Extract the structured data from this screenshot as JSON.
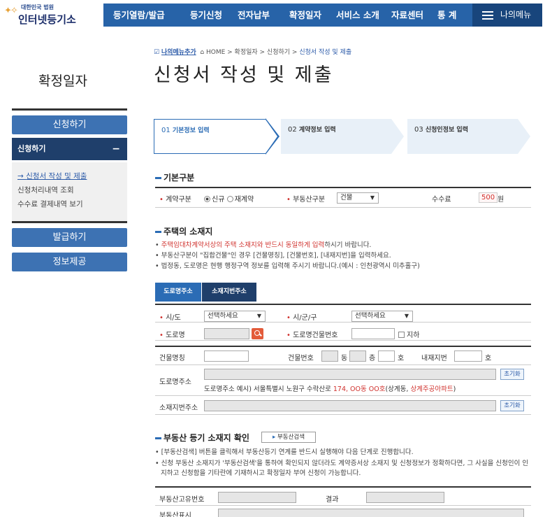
{
  "header": {
    "logo_small": "대한민국 법원",
    "logo_big": "인터넷등기소",
    "nav": [
      "등기열람/발급",
      "등기신청",
      "전자납부",
      "확정일자",
      "서비스 소개",
      "자료센터",
      "통 계"
    ],
    "my_menu": "나의메뉴"
  },
  "sidebar": {
    "title": "확정일자",
    "apply_head": "신청하기",
    "sub_head": "신청하기",
    "sub_toggle": "−",
    "links": [
      "신청서 작성 및 제출",
      "신청처리내역 조회",
      "수수료 결제내역 보기"
    ],
    "issue_head": "발급하기",
    "info_head": "정보제공"
  },
  "breadcrumb": {
    "add_menu": "나의메뉴추가",
    "path": "HOME > 확정일자 > 신청하기 > ",
    "current": "신청서 작성 및 제출"
  },
  "page_title": "신청서 작성 및 제출",
  "steps": [
    {
      "num": "01",
      "label": "기본정보 입력"
    },
    {
      "num": "02",
      "label": "계약정보 입력"
    },
    {
      "num": "03",
      "label": "신청인정보 입력"
    }
  ],
  "basic": {
    "head": "기본구분",
    "contract_label": "계약구분",
    "radio_new": "신규",
    "radio_renew": "재계약",
    "realty_label": "부동산구분",
    "realty_value": "건물",
    "fee_label": "수수료",
    "fee_value": "500",
    "fee_unit": "원"
  },
  "address": {
    "head": "주택의 소재지",
    "note1_red": "주택임대차계약서상의 주택 소재지와 반드시 동일하게 입력",
    "note1_rest": "하시기 바랍니다.",
    "note2": "부동산구분이 \"집합건물\"인 경우 [건물명칭], [건물번호], [내재지번]을 입력하세요.",
    "note3": "법정동, 도로명은 현행 행정구역 정보를 입력해 주시기 바랍니다.(예시 : 인천광역시 미추홀구)",
    "tab_road": "도로명주소",
    "tab_lot": "소재지번주소",
    "sido_label": "시/도",
    "sido_value": "선택하세요",
    "sigungu_label": "시/군/구",
    "sigungu_value": "선택하세요",
    "road_label": "도로명",
    "building_no_label": "도로명건물번호",
    "basement_label": "지하",
    "bname_label": "건물명칭",
    "bnum_label": "건물번호",
    "dong": "동",
    "floor": "층",
    "ho": "호",
    "inner_label": "내재지번",
    "inner_ho": "호",
    "road_addr_label": "도로명주소",
    "reset1": "초기화",
    "example_prefix": "도로명주소 예시) 서울특별시 노원구 수락산로 ",
    "example_red1": "174, OO동 OO호",
    "example_mid": "(상계동, ",
    "example_red2": "상계주공아파트",
    "example_end": ")",
    "lot_addr_label": "소재지번주소",
    "reset2": "초기화"
  },
  "confirm": {
    "head": "부동산 등기 소재지 확인",
    "search_btn": "부동산검색",
    "note1": "[부동산검색] 버튼을 클릭해서 부동산등기 연계를 반드시 실행해야 다음 단계로 진행합니다.",
    "note2": "신청 부동산 소재지가 '부동산검색'을 통하여 확인되지 않더라도 계약증서상 소재지 및 신청정보가 정확하다면, 그 사실을 신청인이 인",
    "note3": "지하고 신청함을 기타란에 기재하시고 확정일자 부여 신청이 가능합니다.",
    "unique_label": "부동산고유번호",
    "result_label": "결과",
    "display_label": "부동산표시"
  }
}
